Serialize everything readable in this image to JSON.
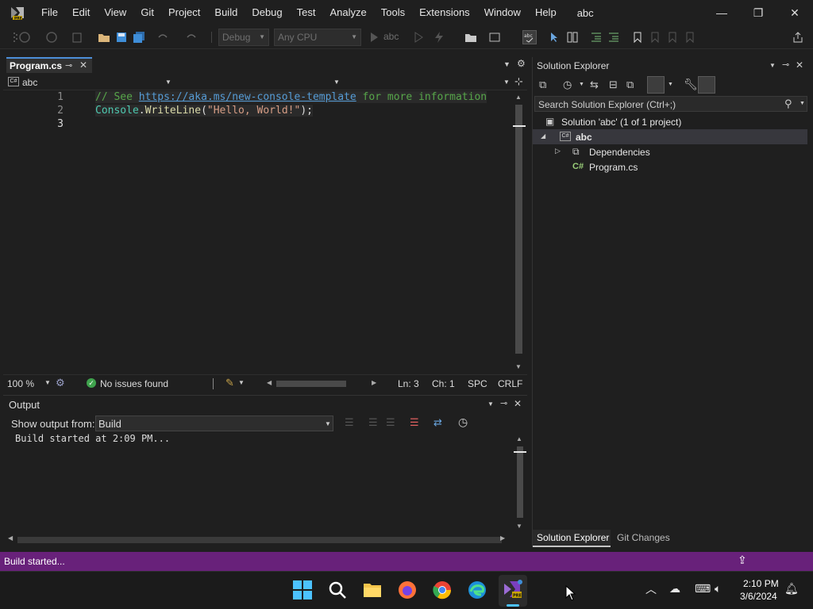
{
  "menu": {
    "items": [
      "File",
      "Edit",
      "View",
      "Git",
      "Project",
      "Build",
      "Debug",
      "Test",
      "Analyze",
      "Tools",
      "Extensions",
      "Window",
      "Help"
    ],
    "solution_name": "abc"
  },
  "window_controls": {
    "minimize": "—",
    "restore": "❐",
    "close": "✕"
  },
  "toolbar": {
    "config": "Debug",
    "platform": "Any CPU",
    "start_target": "abc"
  },
  "editor": {
    "tab_label": "Program.cs",
    "nav_project": "abc",
    "line_numbers": [
      "1",
      "2",
      "3"
    ],
    "code": {
      "line1_comment_a": "// See ",
      "line1_link": "https://aka.ms/new-console-template",
      "line1_comment_b": " for more information",
      "line2_class": "Console",
      "line2_dot": ".",
      "line2_method": "WriteLine",
      "line2_paren_open": "(",
      "line2_string": "\"Hello, World!\"",
      "line2_tail": ");"
    },
    "zoom": "100 %",
    "issues": "No issues found",
    "ln": "Ln: 3",
    "ch": "Ch: 1",
    "whitespace": "SPC",
    "line_ending": "CRLF"
  },
  "output": {
    "title": "Output",
    "show_from_label": "Show output from:",
    "source": "Build",
    "text": "Build started at 2:09 PM..."
  },
  "solution_explorer": {
    "title": "Solution Explorer",
    "search_placeholder": "Search Solution Explorer (Ctrl+;)",
    "solution_label": "Solution 'abc' (1 of 1 project)",
    "project": "abc",
    "dependencies": "Dependencies",
    "file": "Program.cs",
    "bottom_tabs": [
      "Solution Explorer",
      "Git Changes"
    ]
  },
  "statusbar": {
    "text": "Build started..."
  },
  "taskbar": {
    "time": "2:10 PM",
    "date": "3/6/2024"
  },
  "colors": {
    "accent": "#68217a",
    "comment": "#57a64a",
    "link": "#569cd6",
    "class": "#4ec9b0",
    "method": "#dcdcaa",
    "string": "#d69d85"
  }
}
